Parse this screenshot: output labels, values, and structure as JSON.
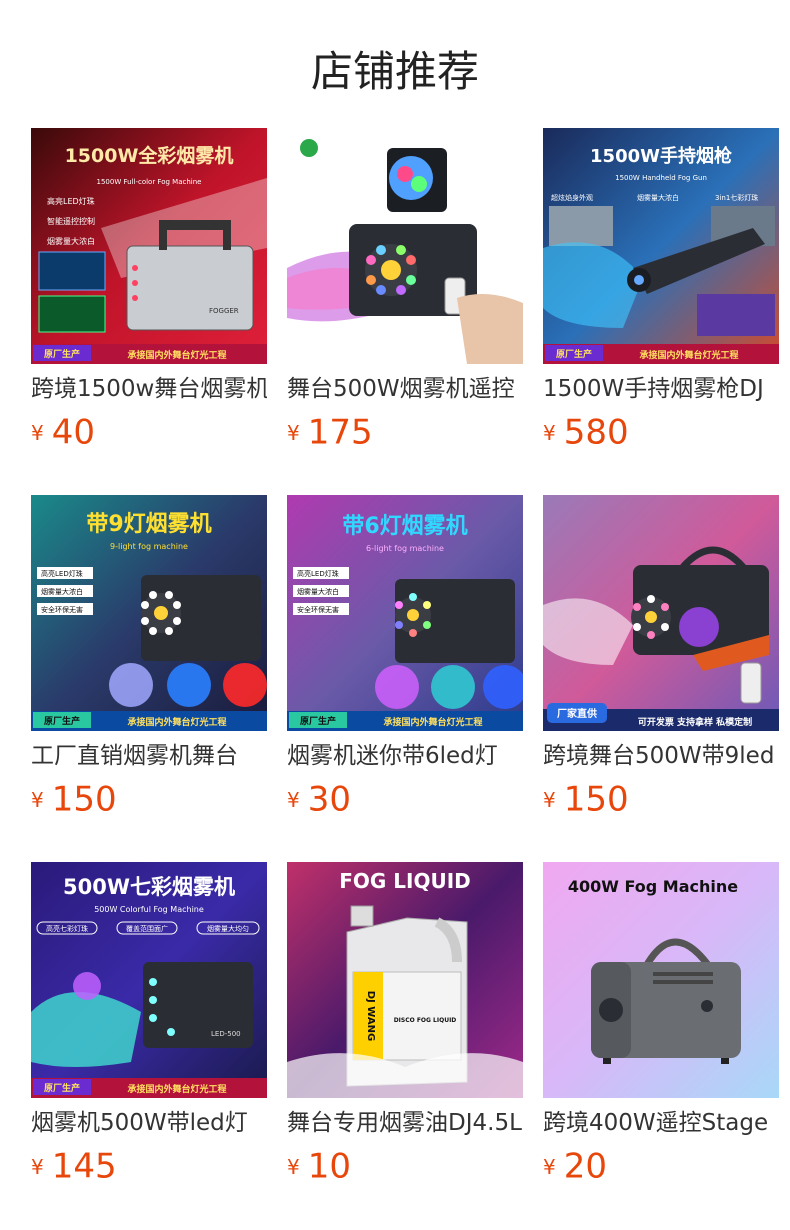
{
  "title": "店铺推荐",
  "currency": "¥",
  "accent_color": "#e8470c",
  "products": [
    {
      "name": "跨境1500w舞台烟雾机",
      "price": "40",
      "img_title": "1500W全彩烟雾机",
      "img_sub": "1500W Full-color Fog Machine",
      "img_features": [
        "高亮LED灯珠",
        "智能遥控控制",
        "烟雾量大浓白"
      ],
      "img_badge": "原厂生产",
      "img_footer": "承接国内外舞台灯光工程",
      "img_brand": "FOGGER"
    },
    {
      "name": "舞台500W烟雾机遥控",
      "price": "175"
    },
    {
      "name": "1500W手持烟雾枪DJ",
      "price": "580",
      "img_title": "1500W手持烟枪",
      "img_sub": "1500W Handheld Fog Gun",
      "img_features": [
        "超炫焰身外观",
        "烟雾量大浓白",
        "3in1七彩灯珠"
      ],
      "img_badge": "原厂生产",
      "img_footer": "承接国内外舞台灯光工程"
    },
    {
      "name": "工厂直销烟雾机舞台",
      "price": "150",
      "img_title": "带9灯烟雾机",
      "img_sub": "9-light fog machine",
      "img_features": [
        "高亮LED灯珠",
        "烟雾量大浓白",
        "安全环保无害"
      ],
      "img_badge": "原厂生产",
      "img_footer": "承接国内外舞台灯光工程"
    },
    {
      "name": "烟雾机迷你带6led灯",
      "price": "30",
      "img_title": "带6灯烟雾机",
      "img_sub": "6-light fog machine",
      "img_features": [
        "高亮LED灯珠",
        "烟雾量大浓白",
        "安全环保无害"
      ],
      "img_badge": "原厂生产",
      "img_footer": "承接国内外舞台灯光工程"
    },
    {
      "name": "跨境舞台500W带9led",
      "price": "150",
      "img_badge": "厂家直供",
      "img_footer": "可开发票  支持拿样  私模定制"
    },
    {
      "name": "烟雾机500W带led灯",
      "price": "145",
      "img_title": "500W七彩烟雾机",
      "img_sub": "500W Colorful Fog Machine",
      "img_features": [
        "高亮七彩灯珠",
        "覆盖范围面广",
        "烟雾量大均匀"
      ],
      "img_badge": "原厂生产",
      "img_footer": "承接国内外舞台灯光工程",
      "img_brand": "LED-500"
    },
    {
      "name": "舞台专用烟雾油DJ4.5L",
      "price": "10",
      "img_title": "FOG LIQUID",
      "img_brand": "DJ WANG",
      "img_sub": "DISCO FOG LIQUID"
    },
    {
      "name": "跨境400W遥控Stage",
      "price": "20",
      "img_title": "400W Fog Machine"
    }
  ]
}
